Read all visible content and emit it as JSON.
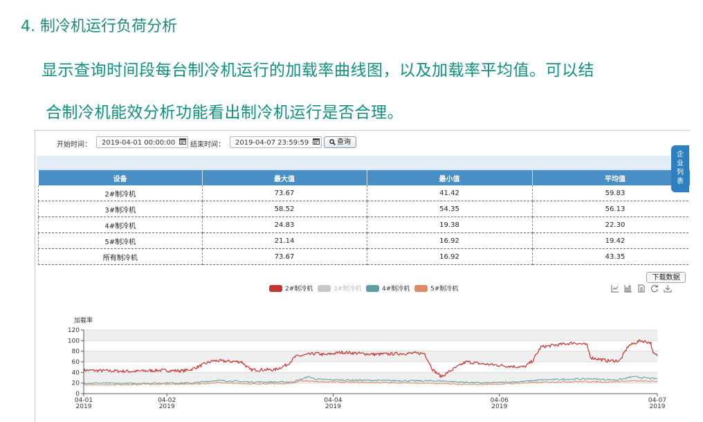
{
  "heading": "4. 制冷机运行负荷分析",
  "paragraph": {
    "line1": "显示查询时间段每台制冷机运行的加载率曲线图，以及加载率平均值。可以结",
    "line2": "合制冷机能效分析功能看出制冷机运行是否合理。"
  },
  "toolbar": {
    "start_label": "开始时间：",
    "start_value": "2019-04-01 00:00:00",
    "end_label": "结束时间：",
    "end_value": "2019-04-07 23:59:59",
    "query_label": "查询"
  },
  "side_tab": [
    "企",
    "业",
    "列",
    "表"
  ],
  "table": {
    "headers": [
      "设备",
      "最大值",
      "最小值",
      "平均值"
    ],
    "rows": [
      [
        "2#制冷机",
        "73.67",
        "41.42",
        "59.83"
      ],
      [
        "3#制冷机",
        "58.52",
        "54.35",
        "56.13"
      ],
      [
        "4#制冷机",
        "24.83",
        "19.38",
        "22.30"
      ],
      [
        "5#制冷机",
        "21.14",
        "16.92",
        "19.42"
      ],
      [
        "所有制冷机",
        "73.67",
        "16.92",
        "43.35"
      ]
    ]
  },
  "download_label": "下载数据",
  "icons": [
    "line-chart-icon",
    "bar-chart-icon",
    "data-view-icon",
    "refresh-icon",
    "save-image-icon"
  ],
  "chart_data": {
    "type": "line",
    "ylabel": "加载率",
    "ylim": [
      0,
      120
    ],
    "yticks": [
      0,
      20,
      40,
      60,
      80,
      100,
      120
    ],
    "xlim_days": [
      0,
      6.9
    ],
    "xtick_labels": [
      {
        "day": 0,
        "line1": "04-01",
        "line2": "2019"
      },
      {
        "day": 1,
        "line1": "04-02",
        "line2": "2019"
      },
      {
        "day": 3,
        "line1": "04-04",
        "line2": "2019"
      },
      {
        "day": 5,
        "line1": "04-06",
        "line2": "2019"
      },
      {
        "day": 6.9,
        "line1": "04-07",
        "line2": "2019"
      }
    ],
    "grid": true,
    "legend_position": "top-center",
    "series": [
      {
        "name": "2#制冷机",
        "color": "#c23531",
        "visible": true,
        "points": [
          [
            0,
            44
          ],
          [
            0.3,
            43
          ],
          [
            0.6,
            42
          ],
          [
            0.9,
            44
          ],
          [
            1.2,
            43
          ],
          [
            1.3,
            46
          ],
          [
            1.55,
            62
          ],
          [
            1.9,
            60
          ],
          [
            2.0,
            45
          ],
          [
            2.3,
            45
          ],
          [
            2.45,
            55
          ],
          [
            2.55,
            70
          ],
          [
            2.8,
            76
          ],
          [
            2.9,
            73
          ],
          [
            3.1,
            78
          ],
          [
            3.5,
            74
          ],
          [
            3.9,
            76
          ],
          [
            4.1,
            76
          ],
          [
            4.15,
            60
          ],
          [
            4.2,
            45
          ],
          [
            4.3,
            32
          ],
          [
            4.4,
            42
          ],
          [
            4.6,
            60
          ],
          [
            4.8,
            56
          ],
          [
            5.1,
            52
          ],
          [
            5.3,
            50
          ],
          [
            5.4,
            62
          ],
          [
            5.5,
            88
          ],
          [
            5.7,
            92
          ],
          [
            5.9,
            96
          ],
          [
            6.05,
            92
          ],
          [
            6.1,
            68
          ],
          [
            6.3,
            62
          ],
          [
            6.45,
            62
          ],
          [
            6.55,
            90
          ],
          [
            6.7,
            100
          ],
          [
            6.82,
            96
          ],
          [
            6.85,
            75
          ],
          [
            6.9,
            72
          ]
        ]
      },
      {
        "name": "3#制冷机",
        "color": "#c8c8c8",
        "visible": false,
        "points": []
      },
      {
        "name": "4#制冷机",
        "color": "#5f9ea0",
        "points": [
          [
            0,
            20
          ],
          [
            0.5,
            19
          ],
          [
            1.0,
            20
          ],
          [
            1.3,
            20
          ],
          [
            1.6,
            25
          ],
          [
            2.0,
            22
          ],
          [
            2.5,
            22
          ],
          [
            2.6,
            26
          ],
          [
            2.7,
            32
          ],
          [
            2.8,
            27
          ],
          [
            3.0,
            26
          ],
          [
            3.5,
            25
          ],
          [
            4.0,
            24
          ],
          [
            4.3,
            24
          ],
          [
            4.5,
            22
          ],
          [
            4.8,
            20
          ],
          [
            5.0,
            21
          ],
          [
            5.3,
            23
          ],
          [
            5.5,
            26
          ],
          [
            5.8,
            27
          ],
          [
            6.1,
            28
          ],
          [
            6.2,
            27
          ],
          [
            6.4,
            26
          ],
          [
            6.5,
            28
          ],
          [
            6.6,
            32
          ],
          [
            6.8,
            29
          ],
          [
            6.9,
            28
          ]
        ]
      },
      {
        "name": "5#制冷机",
        "color": "#e0896a",
        "points": [
          [
            0,
            17
          ],
          [
            0.5,
            17
          ],
          [
            1.0,
            18
          ],
          [
            1.4,
            18
          ],
          [
            1.6,
            21
          ],
          [
            2.0,
            18
          ],
          [
            2.5,
            19
          ],
          [
            2.6,
            24
          ],
          [
            2.8,
            23
          ],
          [
            3.0,
            22
          ],
          [
            3.5,
            21
          ],
          [
            4.0,
            20
          ],
          [
            4.3,
            19
          ],
          [
            4.6,
            17
          ],
          [
            5.0,
            18
          ],
          [
            5.3,
            20
          ],
          [
            5.6,
            22
          ],
          [
            6.0,
            23
          ],
          [
            6.3,
            22
          ],
          [
            6.6,
            24
          ],
          [
            6.9,
            23
          ]
        ]
      }
    ]
  }
}
